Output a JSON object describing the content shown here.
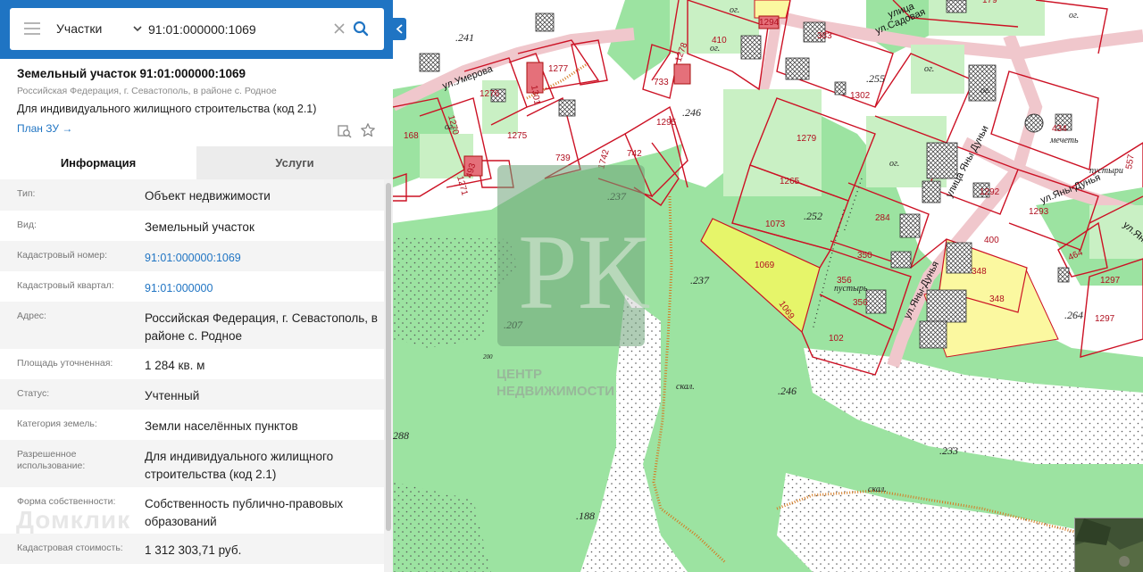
{
  "search": {
    "layer": "Участки",
    "query": "91:01:000000:1069"
  },
  "card": {
    "title": "Земельный участок 91:01:000000:1069",
    "address": "Российская Федерация, г. Севастополь, в районе с. Родное",
    "purpose": "Для индивидуального жилищного строительства (код 2.1)",
    "plan_link": "План ЗУ →"
  },
  "tabs": {
    "info": "Информация",
    "services": "Услуги"
  },
  "properties": [
    {
      "key": "Тип:",
      "value": "Объект недвижимости",
      "link": false
    },
    {
      "key": "Вид:",
      "value": "Земельный участок",
      "link": false
    },
    {
      "key": "Кадастровый номер:",
      "value": "91:01:000000:1069",
      "link": true
    },
    {
      "key": "Кадастровый квартал:",
      "value": "91:01:000000",
      "link": true
    },
    {
      "key": "Адрес:",
      "value": "Российская Федерация, г. Севастополь, в районе с. Родное",
      "link": false
    },
    {
      "key": "Площадь уточненная:",
      "value": "1 284 кв. м",
      "link": false
    },
    {
      "key": "Статус:",
      "value": "Учтенный",
      "link": false
    },
    {
      "key": "Категория земель:",
      "value": "Земли населённых пунктов",
      "link": false
    },
    {
      "key": "Разрешенное использование:",
      "value": "Для индивидуального жилищного строительства (код 2.1)",
      "link": false
    },
    {
      "key": "Форма собственности:",
      "value": "Собственность публично-правовых образований",
      "link": false
    },
    {
      "key": "Кадастровая стоимость:",
      "value": "1 312 303,71 руб.",
      "link": false
    }
  ],
  "watermarks": {
    "domclick": "Домклик",
    "logo_letters": "РК",
    "logo_line1": "ЦЕНТР",
    "logo_line2": "НЕДВИЖИМОСТИ"
  },
  "map": {
    "parcels": [
      "1294",
      "383",
      "410",
      "1277",
      "1276",
      "1301",
      "1278",
      "733",
      "1302",
      "168",
      "1270",
      "1275",
      "1295",
      "739",
      "1742",
      "742",
      "1271",
      "493",
      "1279",
      "1265",
      "1073",
      "284",
      "350",
      "356",
      "356",
      "102",
      "1069",
      "1069",
      "348",
      "348",
      "400",
      "1292",
      "1293",
      "434",
      "464",
      "1297",
      "1297",
      "179",
      "557"
    ],
    "heights": [
      ".241",
      ".246",
      ".255",
      ".237",
      ".252",
      ".237",
      ".207",
      ".246",
      ".233",
      ".188",
      ".264",
      "288",
      "200"
    ],
    "streets": [
      "ул.Садовая",
      "ул.Умерова",
      "улица Яны Дуньи",
      "ул.Яны-Дунья",
      "ул.Яны-Дунья",
      "ул.Яны-Дуньи",
      "улица"
    ],
    "notes": [
      "ог.",
      "ог.",
      "ог.",
      "ог.",
      "ог.",
      "ог.",
      "ог.",
      "мечеть",
      "пустыри",
      "пустырь",
      "скал.",
      "скал."
    ],
    "colors": {
      "forest": "#99e29f",
      "selected": "#e6f56a",
      "neighbor": "#fbf8a0",
      "boundary": "#cc1124"
    }
  }
}
